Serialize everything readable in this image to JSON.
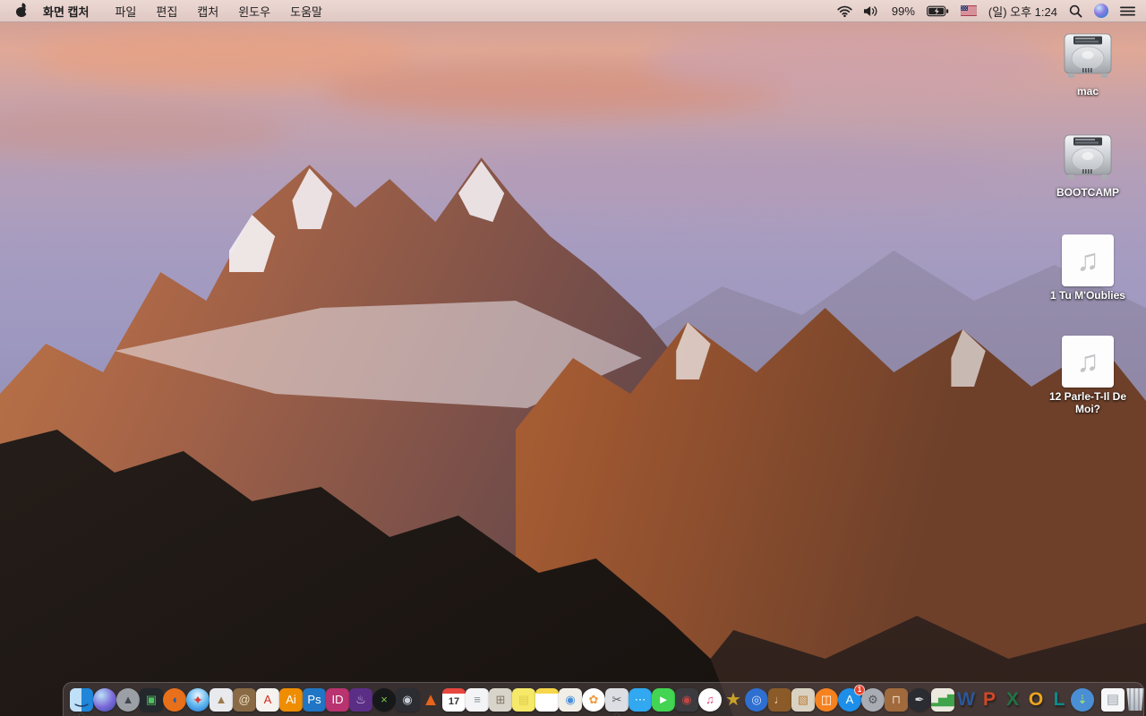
{
  "menu_bar": {
    "app_name": "화면 캡처",
    "menus": [
      "파일",
      "편집",
      "캡처",
      "윈도우",
      "도움말"
    ],
    "status": {
      "battery_percent": "99%",
      "clock": "(일) 오후 1:24",
      "icons": [
        "wifi-icon",
        "volume-icon",
        "battery-charging-icon",
        "us-flag-icon",
        "spotlight-search-icon",
        "siri-icon",
        "notification-center-icon"
      ]
    }
  },
  "desktop": {
    "icons": [
      {
        "label": "mac",
        "type": "hard-drive"
      },
      {
        "label": "BOOTCAMP",
        "type": "hard-drive"
      },
      {
        "label": "1 Tu M'Oublies",
        "type": "audio-file"
      },
      {
        "label": "12 Parle-T-Il De Moi?",
        "type": "audio-file"
      }
    ]
  },
  "dock": {
    "items": [
      {
        "label": "Finder",
        "kind": "finder",
        "glyph": "‿",
        "fg": "#1f3b66",
        "running": true
      },
      {
        "label": "Siri",
        "kind": "siri",
        "glyph": ""
      },
      {
        "label": "Launchpad",
        "kind": "circle",
        "bg": "#9aa0a6",
        "glyph": "▲",
        "fg": "#42474d"
      },
      {
        "label": "Screens App",
        "kind": "square",
        "bg": "#23282c",
        "glyph": "▣",
        "fg": "#4fc15f"
      },
      {
        "label": "Firefox",
        "kind": "circle",
        "bg": "#e8701a",
        "glyph": "◖",
        "fg": "#2a5aa0"
      },
      {
        "label": "Safari",
        "kind": "safari",
        "glyph": "✦",
        "fg": "#e0392f"
      },
      {
        "label": "Preview",
        "kind": "square",
        "bg": "#e9eaee",
        "glyph": "▲",
        "fg": "#9c7b4f"
      },
      {
        "label": "Contacts",
        "kind": "square",
        "bg": "#8a6a45",
        "glyph": "@",
        "fg": "#f0e2c4"
      },
      {
        "label": "Adobe Acrobat",
        "kind": "square",
        "bg": "#f6f3ef",
        "glyph": "A",
        "fg": "#d0281c"
      },
      {
        "label": "Adobe Illustrator",
        "kind": "square",
        "bg": "#ef8d00",
        "glyph": "Ai",
        "fg": "#ffffff"
      },
      {
        "label": "Adobe Photoshop",
        "kind": "square",
        "bg": "#2076c5",
        "glyph": "Ps",
        "fg": "#ffffff"
      },
      {
        "label": "Adobe InDesign",
        "kind": "square",
        "bg": "#b8336f",
        "glyph": "ID",
        "fg": "#ffffff"
      },
      {
        "label": "Toast",
        "kind": "square",
        "bg": "#5b2e86",
        "glyph": "♨",
        "fg": "#d9c6ef"
      },
      {
        "label": "Xee",
        "kind": "circle",
        "bg": "#17181a",
        "glyph": "×",
        "fg": "#7ac943"
      },
      {
        "label": "Disk Tool",
        "kind": "square",
        "bg": "#2c2d33",
        "glyph": "◉",
        "fg": "#c9ced6"
      },
      {
        "label": "VLC",
        "kind": "bare",
        "glyph": "▲",
        "fg": "#e8641b"
      },
      {
        "label": "Calendar",
        "kind": "calendar",
        "glyph": "17",
        "fg": "#333333"
      },
      {
        "label": "Reminders",
        "kind": "square",
        "bg": "#f4f4f6",
        "glyph": "≡",
        "fg": "#8a8f98"
      },
      {
        "label": "Archive Utility",
        "kind": "square",
        "bg": "#d9d4ca",
        "glyph": "⊞",
        "fg": "#7c7566"
      },
      {
        "label": "Stickies",
        "kind": "square",
        "bg": "#f6e868",
        "glyph": "▤",
        "fg": "#e0ce4d"
      },
      {
        "label": "Notes",
        "kind": "notes",
        "glyph": "",
        "fg": "#cccccc"
      },
      {
        "label": "Stamps Document",
        "kind": "square",
        "bg": "#f1eee8",
        "glyph": "◉",
        "fg": "#4a90d9"
      },
      {
        "label": "Photos",
        "kind": "circle",
        "bg": "#ffffff",
        "glyph": "✿",
        "fg": "#f09a3e"
      },
      {
        "label": "Grab",
        "kind": "square",
        "bg": "#dcdee3",
        "glyph": "✂",
        "fg": "#5a5f66",
        "running": true
      },
      {
        "label": "Messages",
        "kind": "bubble",
        "bg": "#31a8f0",
        "glyph": "⋯",
        "fg": "#ffffff"
      },
      {
        "label": "FaceTime",
        "kind": "bubble",
        "bg": "#42d452",
        "glyph": "►",
        "fg": "#ffffff"
      },
      {
        "label": "Photo Booth",
        "kind": "square",
        "bg": "#3b3b40",
        "glyph": "◉",
        "fg": "#c24640"
      },
      {
        "label": "iTunes",
        "kind": "circle",
        "bg": "#ffffff",
        "glyph": "♫",
        "fg": "#e0447a"
      },
      {
        "label": "iMovie HD",
        "kind": "bare",
        "glyph": "★",
        "fg": "#c9a227"
      },
      {
        "label": "iDVD",
        "kind": "circle",
        "bg": "#2e6fd0",
        "glyph": "◎",
        "fg": "#d6e4ff"
      },
      {
        "label": "GarageBand",
        "kind": "square",
        "bg": "#8a5a28",
        "glyph": "♩",
        "fg": "#ecd2a0"
      },
      {
        "label": "Scrapbook",
        "kind": "square",
        "bg": "#d9d2c2",
        "glyph": "▧",
        "fg": "#c07f3a"
      },
      {
        "label": "iBooks",
        "kind": "circle",
        "bg": "#f5821f",
        "glyph": "◫",
        "fg": "#ffffff"
      },
      {
        "label": "App Store",
        "kind": "circle",
        "bg": "#1d8fe8",
        "glyph": "A",
        "fg": "#ffffff",
        "badge": "1"
      },
      {
        "label": "System Preferences",
        "kind": "circle",
        "bg": "#a9adb3",
        "glyph": "⚙",
        "fg": "#53575d"
      },
      {
        "label": "Keynote",
        "kind": "square",
        "bg": "#a06a3c",
        "glyph": "⊓",
        "fg": "#ecd8bc"
      },
      {
        "label": "Pages",
        "kind": "circle",
        "bg": "#2b2b32",
        "glyph": "✒",
        "fg": "#dcdce4"
      },
      {
        "label": "Numbers",
        "kind": "square",
        "bg": "#eceadf",
        "glyph": "▂▅▇",
        "fg": "#3fa44a"
      },
      {
        "label": "Microsoft Word",
        "kind": "letter",
        "glyph": "W",
        "fg": "#2b579a"
      },
      {
        "label": "Microsoft PowerPoint",
        "kind": "letter",
        "glyph": "P",
        "fg": "#d24726"
      },
      {
        "label": "Microsoft Excel",
        "kind": "letter",
        "glyph": "X",
        "fg": "#217346"
      },
      {
        "label": "Microsoft Outlook",
        "kind": "letter",
        "glyph": "O",
        "fg": "#eca51e"
      },
      {
        "label": "Microsoft Lync",
        "kind": "letter",
        "glyph": "L",
        "fg": "#0d8a8a"
      },
      {
        "label": "Web Downloader",
        "kind": "circle",
        "bg": "#4a8fd4",
        "glyph": "⇣",
        "fg": "#a8e86a"
      },
      {
        "divider": true
      },
      {
        "label": "Document File",
        "kind": "doc",
        "glyph": "▤",
        "fg": "#9aa0a8"
      },
      {
        "label": "Trash",
        "kind": "trash",
        "glyph": "",
        "fg": "#6a7078"
      }
    ]
  }
}
